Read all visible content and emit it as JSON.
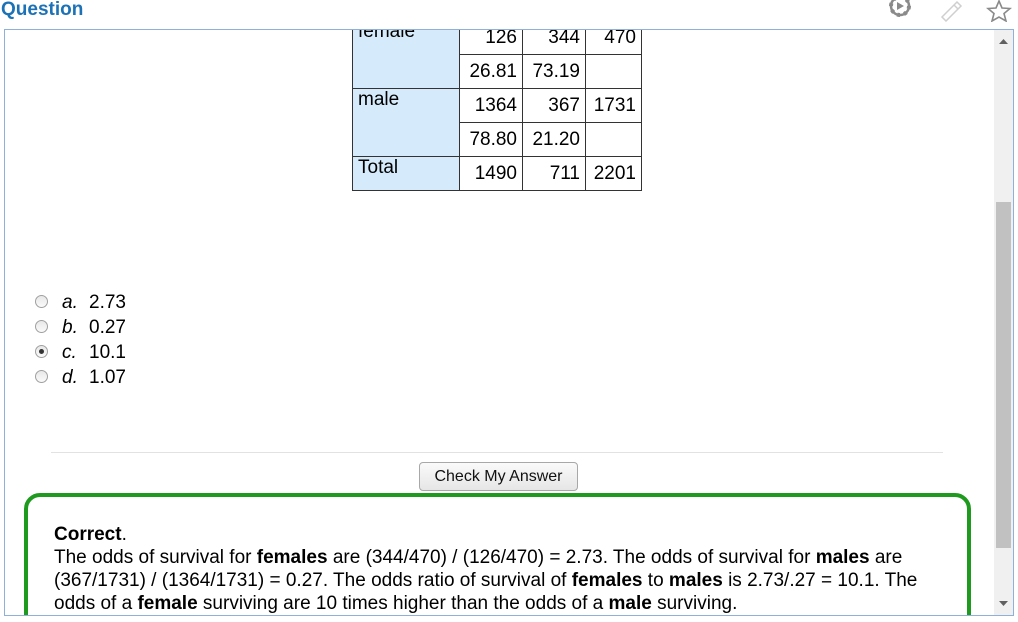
{
  "header": {
    "title": "Question"
  },
  "icons": {
    "settings": "gear-play-icon",
    "edit": "pencil-icon",
    "favorite": "star-icon"
  },
  "table": {
    "rows": [
      {
        "label": "female",
        "lines": [
          [
            "126",
            "344",
            "470"
          ],
          [
            "26.81",
            "73.19",
            ""
          ]
        ]
      },
      {
        "label": "male",
        "lines": [
          [
            "1364",
            "367",
            "1731"
          ],
          [
            "78.80",
            "21.20",
            ""
          ]
        ]
      },
      {
        "label": "Total",
        "lines": [
          [
            "1490",
            "711",
            "2201"
          ]
        ]
      }
    ]
  },
  "options": [
    {
      "letter": "a.",
      "value": "2.73",
      "selected": false
    },
    {
      "letter": "b.",
      "value": "0.27",
      "selected": false
    },
    {
      "letter": "c.",
      "value": "10.1",
      "selected": true
    },
    {
      "letter": "d.",
      "value": "1.07",
      "selected": false
    }
  ],
  "check_button": {
    "label": "Check My Answer"
  },
  "feedback": {
    "title": "Correct",
    "title_suffix": ".",
    "p1": "The odds of survival for ",
    "b1": "females",
    "p2": " are (344/470) / (126/470) = 2.73. The odds of survival for ",
    "b2": "males",
    "p3": " are (367/1731) / (1364/1731) = 0.27. The odds ratio of survival of ",
    "b3": "females",
    "p4": " to ",
    "b4": "males",
    "p5": " is 2.73/.27 = 10.1. The odds of a ",
    "b5": "female",
    "p6": " surviving are 10 times higher than the odds of a ",
    "b6": "male",
    "p7": " surviving."
  }
}
